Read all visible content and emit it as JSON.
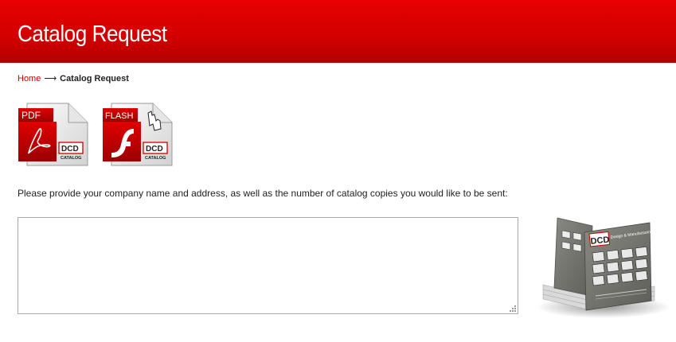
{
  "header": {
    "title": "Catalog Request"
  },
  "breadcrumb": {
    "home": "Home",
    "separator": "⟶",
    "current": "Catalog Request"
  },
  "downloads": {
    "pdf": {
      "badge": "PDF",
      "brand": "DCD",
      "caption": "CATALOG",
      "icon": "pdf-document-icon"
    },
    "flash": {
      "badge": "FLASH",
      "brand": "DCD",
      "caption": "CATALOG",
      "icon": "flash-document-icon"
    }
  },
  "form": {
    "instructions": "Please provide your company name and address, as well as the number of catalog copies you would like to be sent:",
    "request_value": ""
  },
  "catalog_image": {
    "brand": "DCD",
    "subtitle": "Design & Manufacturing Ltd.",
    "icon": "catalog-stack-photo"
  },
  "colors": {
    "header_red": "#d40000",
    "link_red": "#cc0000",
    "text": "#222222"
  }
}
